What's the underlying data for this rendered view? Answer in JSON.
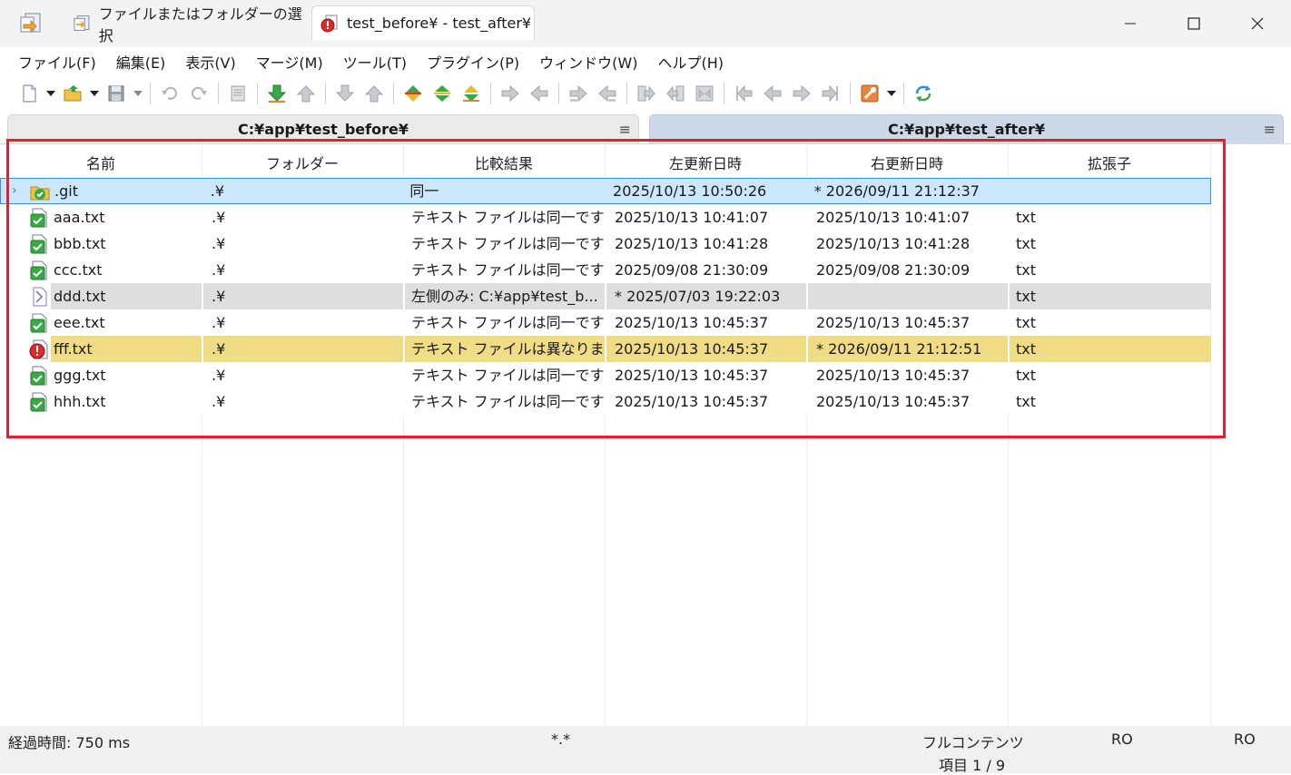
{
  "titlebar": {
    "tabs": [
      {
        "label": "ファイルまたはフォルダーの選択"
      },
      {
        "label": "test_before¥ - test_after¥"
      }
    ]
  },
  "menu": {
    "items": [
      "ファイル(F)",
      "編集(E)",
      "表示(V)",
      "マージ(M)",
      "ツール(T)",
      "プラグイン(P)",
      "ウィンドウ(W)",
      "ヘルプ(H)"
    ]
  },
  "paths": {
    "left": "C:¥app¥test_before¥",
    "right": "C:¥app¥test_after¥",
    "menu_glyph": "≡"
  },
  "columns": [
    "名前",
    "フォルダー",
    "比較結果",
    "左更新日時",
    "右更新日時",
    "拡張子"
  ],
  "rows": [
    {
      "name": ".git",
      "folder": ".¥",
      "result": "同一",
      "ldate": "2025/10/13 10:50:26",
      "rdate": "* 2026/09/11 21:12:37",
      "ext": "",
      "icon": "folder-check-icon",
      "state": "selected"
    },
    {
      "name": "aaa.txt",
      "folder": ".¥",
      "result": "テキスト ファイルは同一です",
      "ldate": "2025/10/13 10:41:07",
      "rdate": "2025/10/13 10:41:07",
      "ext": "txt",
      "icon": "file-check-icon",
      "state": "normal"
    },
    {
      "name": "bbb.txt",
      "folder": ".¥",
      "result": "テキスト ファイルは同一です",
      "ldate": "2025/10/13 10:41:28",
      "rdate": "2025/10/13 10:41:28",
      "ext": "txt",
      "icon": "file-check-icon",
      "state": "normal"
    },
    {
      "name": "ccc.txt",
      "folder": ".¥",
      "result": "テキスト ファイルは同一です",
      "ldate": "2025/09/08 21:30:09",
      "rdate": "2025/09/08 21:30:09",
      "ext": "txt",
      "icon": "file-check-icon",
      "state": "normal"
    },
    {
      "name": "ddd.txt",
      "folder": ".¥",
      "result": "左側のみ: C:¥app¥test_b...",
      "ldate": "* 2025/07/03 19:22:03",
      "rdate": "",
      "ext": "txt",
      "icon": "file-left-only-icon",
      "state": "gray"
    },
    {
      "name": "eee.txt",
      "folder": ".¥",
      "result": "テキスト ファイルは同一です",
      "ldate": "2025/10/13 10:45:37",
      "rdate": "2025/10/13 10:45:37",
      "ext": "txt",
      "icon": "file-check-icon",
      "state": "normal"
    },
    {
      "name": "fff.txt",
      "folder": ".¥",
      "result": "テキスト ファイルは異なります",
      "ldate": "2025/10/13 10:45:37",
      "rdate": "* 2026/09/11 21:12:51",
      "ext": "txt",
      "icon": "file-diff-icon",
      "state": "yellow"
    },
    {
      "name": "ggg.txt",
      "folder": ".¥",
      "result": "テキスト ファイルは同一です",
      "ldate": "2025/10/13 10:45:37",
      "rdate": "2025/10/13 10:45:37",
      "ext": "txt",
      "icon": "file-check-icon",
      "state": "normal"
    },
    {
      "name": "hhh.txt",
      "folder": ".¥",
      "result": "テキスト ファイルは同一です",
      "ldate": "2025/10/13 10:45:37",
      "rdate": "2025/10/13 10:45:37",
      "ext": "txt",
      "icon": "file-check-icon",
      "state": "normal"
    }
  ],
  "statusbar": {
    "elapsed": "経過時間: 750 ms",
    "filter": "*.*",
    "mode": "フルコンテンツ",
    "items": "項目 1 / 9",
    "left_ro": "RO",
    "right_ro": "RO"
  },
  "colors": {
    "selected_bg": "#cce6fb",
    "left_only_bg": "#dedede",
    "diff_bg": "#f0dc84",
    "highlight_border": "#e0222f"
  }
}
